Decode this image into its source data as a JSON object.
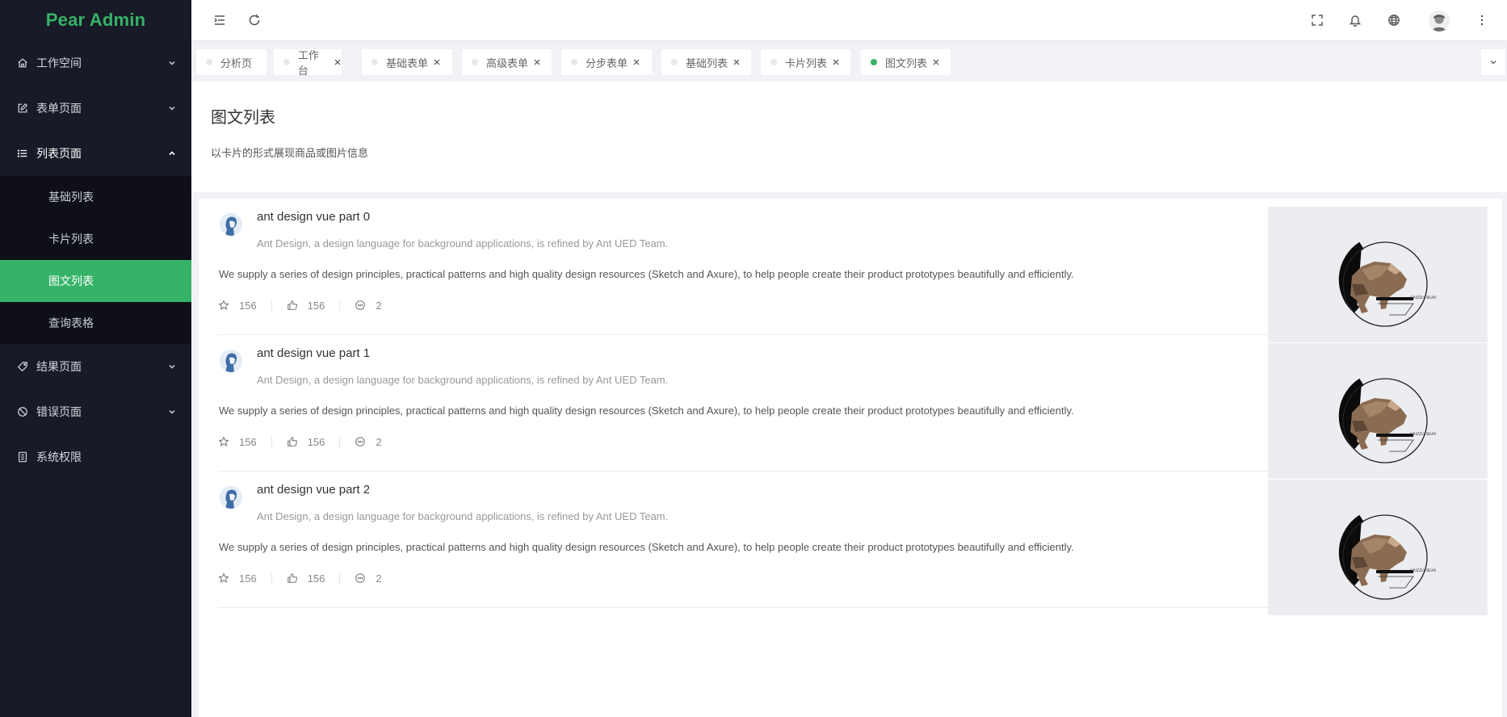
{
  "app": {
    "name": "Pear Admin"
  },
  "sidebar": {
    "items": [
      {
        "label": "工作空间",
        "icon": "home-icon"
      },
      {
        "label": "表单页面",
        "icon": "edit-icon"
      },
      {
        "label": "列表页面",
        "icon": "list-icon"
      },
      {
        "label": "结果页面",
        "icon": "tag-icon"
      },
      {
        "label": "错误页面",
        "icon": "ban-icon"
      },
      {
        "label": "系统权限",
        "icon": "permission-icon"
      }
    ],
    "submenu": [
      "基础列表",
      "卡片列表",
      "图文列表",
      "查询表格"
    ],
    "active_sub": "图文列表"
  },
  "header": {
    "icons": [
      "menu-toggle-icon",
      "refresh-icon",
      "fullscreen-icon",
      "bell-icon",
      "globe-icon",
      "user-avatar",
      "more-vertical-icon"
    ]
  },
  "tabs": [
    {
      "label": "分析页",
      "closable": false
    },
    {
      "label": "工作台",
      "closable": true
    },
    {
      "label": "基础表单",
      "closable": true
    },
    {
      "label": "高级表单",
      "closable": true
    },
    {
      "label": "分步表单",
      "closable": true
    },
    {
      "label": "基础列表",
      "closable": true
    },
    {
      "label": "卡片列表",
      "closable": true
    },
    {
      "label": "图文列表",
      "closable": true,
      "active": true
    }
  ],
  "page": {
    "title": "图文列表",
    "description": "以卡片的形式展现商品或图片信息"
  },
  "list": [
    {
      "title": "ant design vue part 0",
      "subtitle": "Ant Design, a design language for background applications, is refined by Ant UED Team.",
      "content": "We supply a series of design principles, practical patterns and high quality design resources (Sketch and Axure), to help people create their product prototypes beautifully and efficiently.",
      "stars": "156",
      "likes": "156",
      "comments": "2",
      "image_caption": "GRIZZLY BEAR"
    },
    {
      "title": "ant design vue part 1",
      "subtitle": "Ant Design, a design language for background applications, is refined by Ant UED Team.",
      "content": "We supply a series of design principles, practical patterns and high quality design resources (Sketch and Axure), to help people create their product prototypes beautifully and efficiently.",
      "stars": "156",
      "likes": "156",
      "comments": "2",
      "image_caption": "GRIZZLY BEAR"
    },
    {
      "title": "ant design vue part 2",
      "subtitle": "Ant Design, a design language for background applications, is refined by Ant UED Team.",
      "content": "We supply a series of design principles, practical patterns and high quality design resources (Sketch and Axure), to help people create their product prototypes beautifully and efficiently.",
      "stars": "156",
      "likes": "156",
      "comments": "2",
      "image_caption": "GRIZZLY BEAR"
    }
  ],
  "colors": {
    "brand": "#36b368",
    "sidebar_bg": "#181a27",
    "submenu_bg": "#0f1017"
  }
}
